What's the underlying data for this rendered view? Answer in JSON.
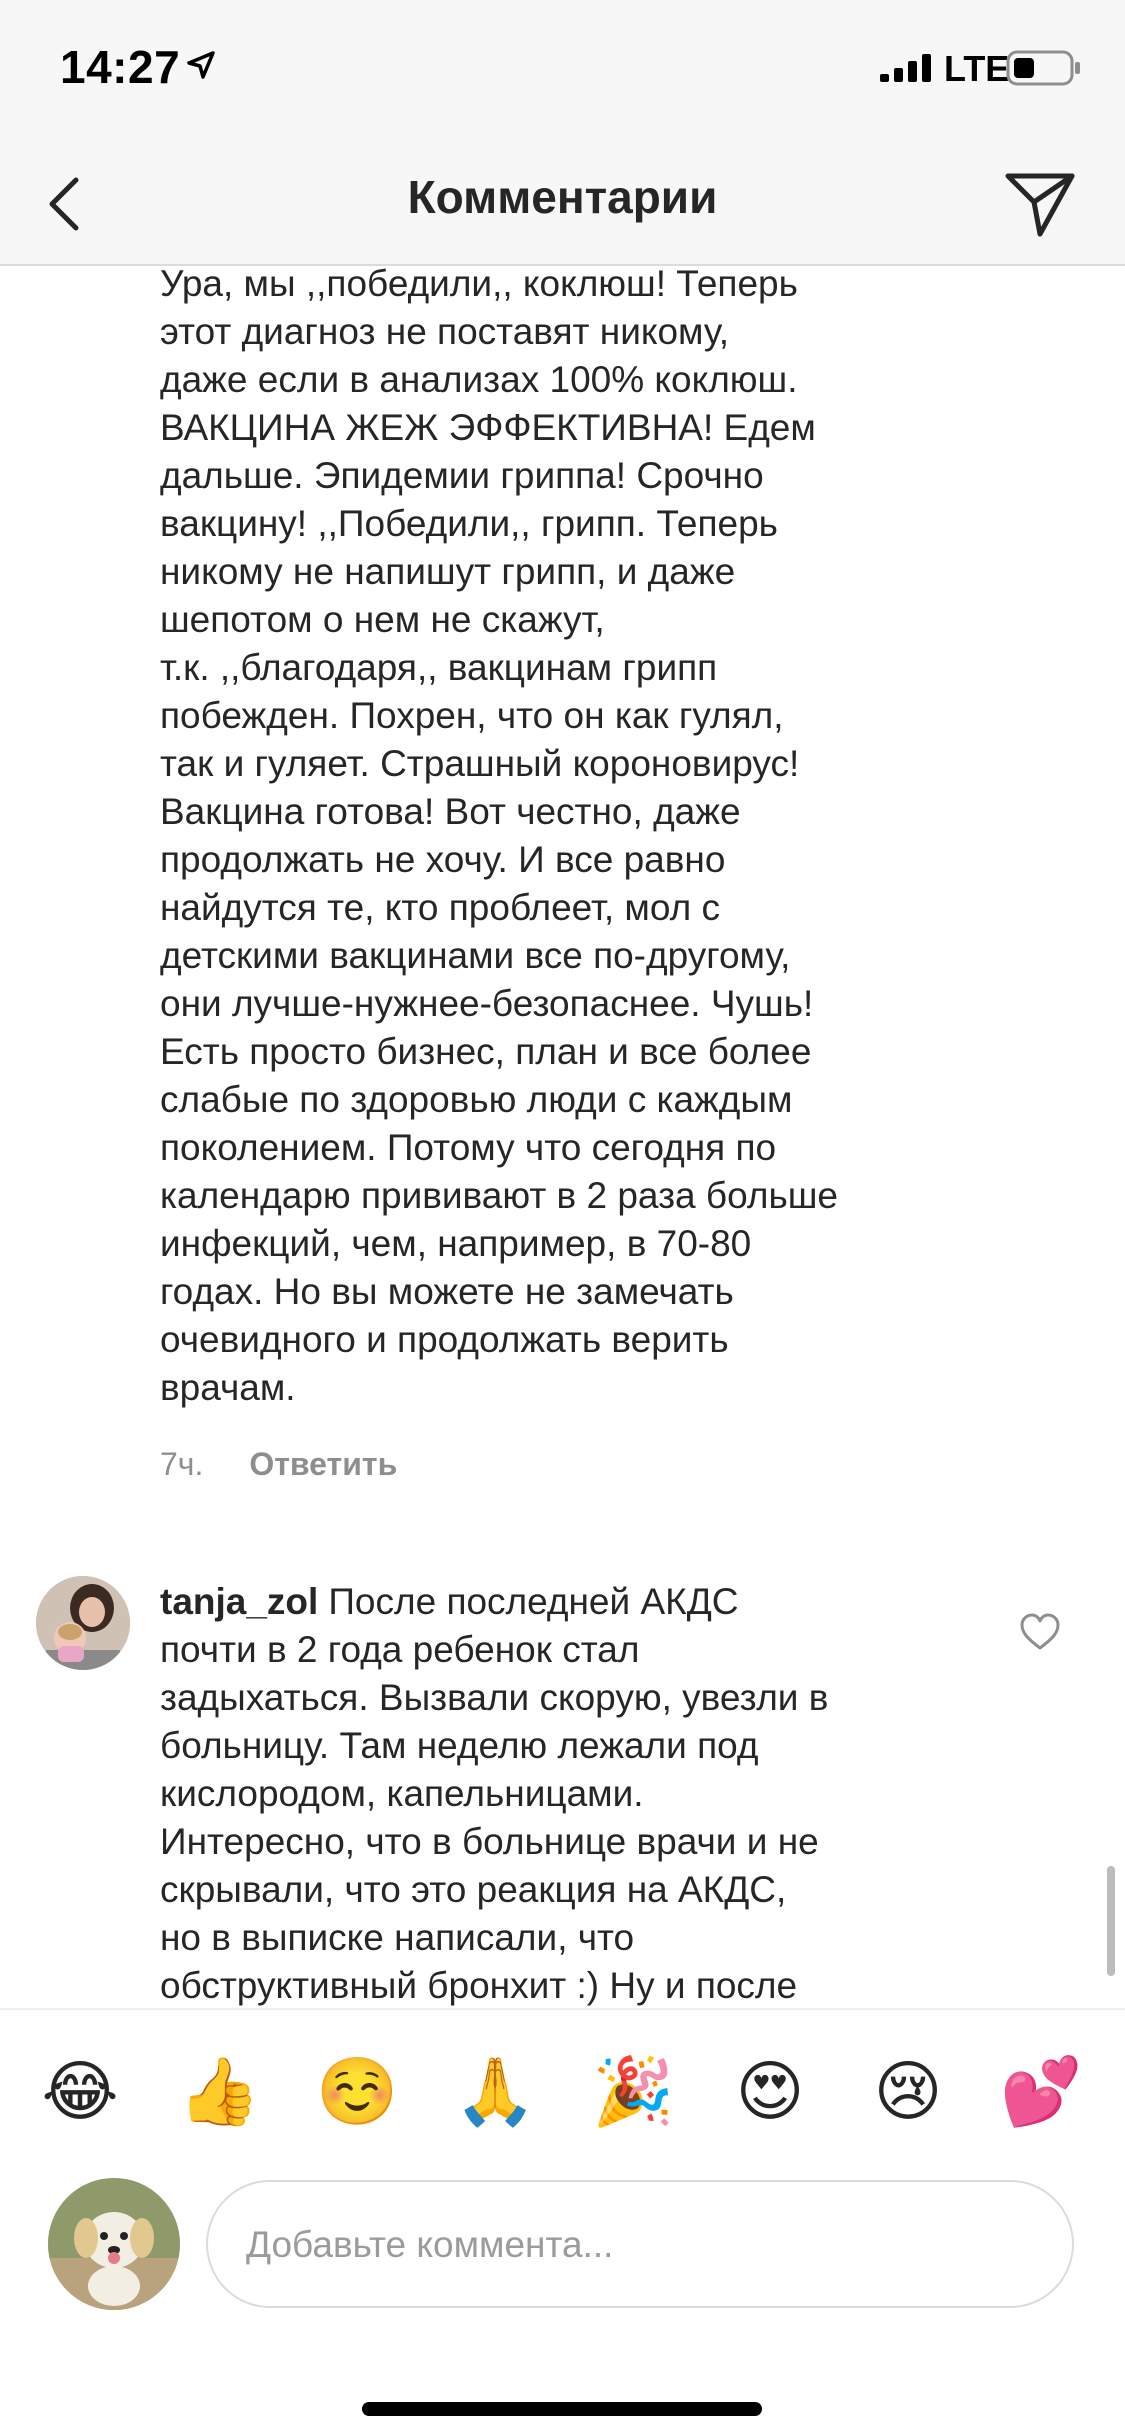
{
  "status_bar": {
    "time": "14:27",
    "network": "LTE"
  },
  "header": {
    "title": "Комментарии"
  },
  "comments": [
    {
      "text": "Ура, мы ,,победили,, коклюш! Теперь\nэтот диагноз не поставят никому,\nдаже если в анализах 100% коклюш.\nВАКЦИНА ЖЕЖ ЭФФЕКТИВНА! Едем\nдальше. Эпидемии гриппа! Срочно\nвакцину! ,,Победили,, грипп. Теперь\nникому не напишут грипп, и даже\nшепотом о нем не скажут,\nт.к. ,,благодаря,, вакцинам грипп\nпобежден. Похрен, что он как гулял,\nтак и гуляет. Страшный короновирус!\nВакцина готова! Вот честно, даже\nпродолжать не хочу. И все равно\nнайдутся те, кто проблеет, мол с\nдетскими вакцинами все по-другому,\nони лучше-нужнее-безопаснее. Чушь!\nЕсть просто бизнес, план и все более\nслабые по здоровью люди с каждым\nпоколением. Потому что сегодня по\nкалендарю прививают в 2 раза больше\nинфекций, чем, например, в 70-80\nгодах. Но вы можете не замечать\nочевидного и продолжать верить\nврачам.",
      "time": "7ч.",
      "reply_label": "Ответить"
    },
    {
      "username": "tanja_zol",
      "text": "После последней АКДС\nпочти в 2 года ребенок стал\nзадыхаться. Вызвали скорую, увезли в\nбольницу. Там неделю лежали под\nкислородом, капельницами.\nИнтересно, что в больнице врачи и не\nскрывали, что это реакция на АКДС,\nно в выписке написали, что\nобструктивный бронхит :) Ну и после"
    }
  ],
  "emojis": [
    "😂",
    "👍",
    "☺️",
    "🙏",
    "🎉",
    "😍",
    "😢",
    "💕"
  ],
  "input": {
    "placeholder": "Добавьте коммента..."
  }
}
